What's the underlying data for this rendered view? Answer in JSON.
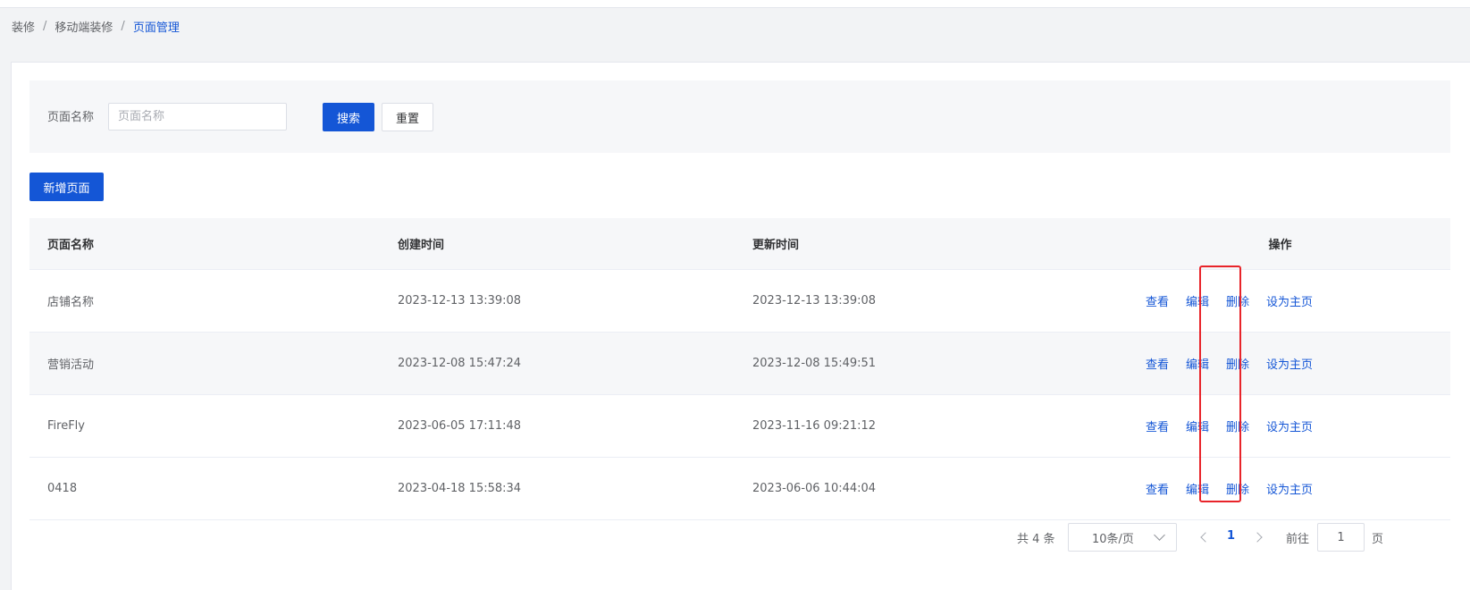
{
  "breadcrumb": {
    "items": [
      "装修",
      "移动端装修",
      "页面管理"
    ],
    "separator": "/"
  },
  "search": {
    "label": "页面名称",
    "placeholder": "页面名称",
    "value": "",
    "search_button": "搜索",
    "reset_button": "重置"
  },
  "toolbar": {
    "add_button": "新增页面"
  },
  "table": {
    "columns": [
      "页面名称",
      "创建时间",
      "更新时间",
      "操作"
    ],
    "rows": [
      {
        "name": "店铺名称",
        "created": "2023-12-13 13:39:08",
        "updated": "2023-12-13 13:39:08"
      },
      {
        "name": "营销活动",
        "created": "2023-12-08 15:47:24",
        "updated": "2023-12-08 15:49:51"
      },
      {
        "name": "FireFly",
        "created": "2023-06-05 17:11:48",
        "updated": "2023-11-16 09:21:12"
      },
      {
        "name": "0418",
        "created": "2023-04-18 15:58:34",
        "updated": "2023-06-06 10:44:04"
      }
    ],
    "actions": {
      "view": "查看",
      "edit": "编辑",
      "delete": "删除",
      "set_home": "设为主页"
    }
  },
  "pagination": {
    "total_text": "共 4 条",
    "page_size": "10条/页",
    "current_page": "1",
    "goto_label": "前往",
    "goto_value": "1",
    "goto_suffix": "页"
  },
  "colors": {
    "primary": "#1456d6",
    "highlight": "#e8242a"
  },
  "icons": {
    "prev": "chevron-left-icon",
    "next": "chevron-right-icon",
    "dropdown": "chevron-down-icon"
  }
}
